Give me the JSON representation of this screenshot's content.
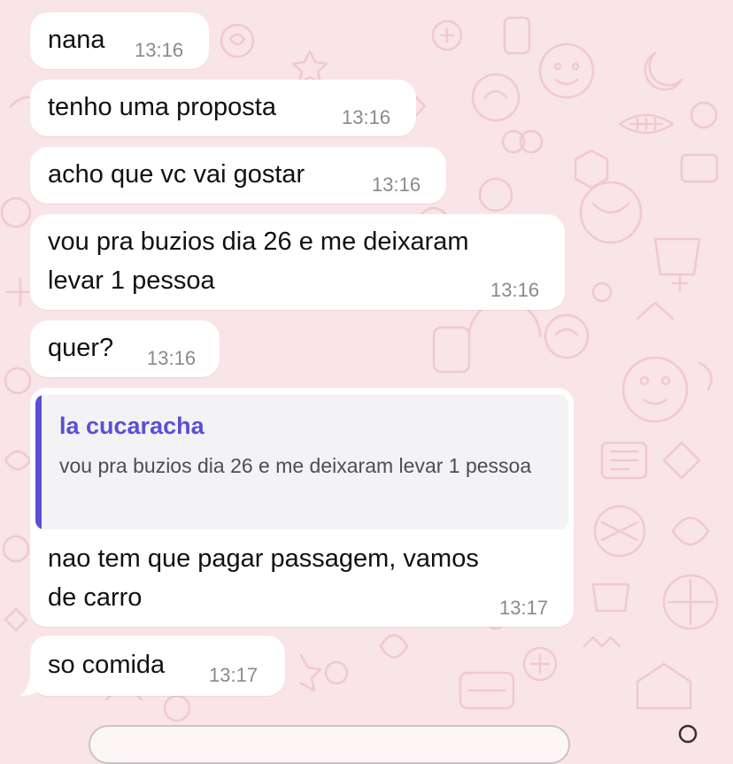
{
  "theme": {
    "background": "#f9e4e7",
    "bubble": "#ffffff",
    "timestamp": "#8a8a8e",
    "quote_accent": "#5a4fd6"
  },
  "messages": [
    {
      "text": "nana",
      "time": "13:16"
    },
    {
      "text": "tenho uma proposta",
      "time": "13:16"
    },
    {
      "text": "acho que vc vai gostar",
      "time": "13:16"
    },
    {
      "text_line1": "vou pra buzios dia 26 e me deixaram",
      "text_line2": "levar 1 pessoa",
      "time": "13:16"
    },
    {
      "text": "quer?",
      "time": "13:16"
    },
    {
      "reply_to": {
        "author": "la cucaracha",
        "text": "vou pra buzios dia 26 e me deixaram levar 1 pessoa"
      },
      "text_line1": "nao tem que pagar passagem, vamos",
      "text_line2": "de carro",
      "time": "13:17"
    },
    {
      "text": "so comida",
      "time": "13:17"
    }
  ]
}
